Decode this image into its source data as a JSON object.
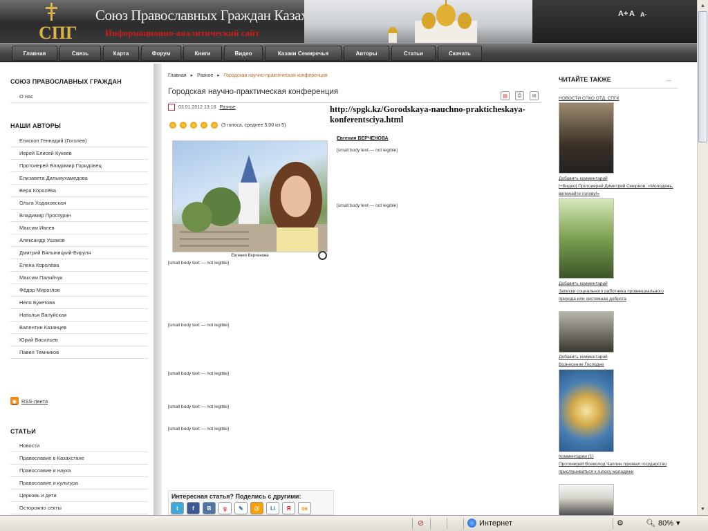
{
  "header": {
    "title": "Союз Православных Граждан Казахстана",
    "subtitle": "Информационно-аналитический сайт",
    "logo_text": "СПГ",
    "font_controls": [
      "A+",
      "A",
      "A-"
    ]
  },
  "nav": {
    "items": [
      "Главная",
      "Связь",
      "Карта",
      "Форум",
      "Книги",
      "Видео",
      "Казаки Семиречья",
      "Авторы",
      "Статьи",
      "Скачать"
    ]
  },
  "left": {
    "section1_title": "СОЮЗ ПРАВОСЛАВНЫХ ГРАЖДАН",
    "section1_items": [
      "О нас"
    ],
    "section2_title": "НАШИ АВТОРЫ",
    "authors": [
      "Епископ Геннадий (Гоголев)",
      "Иерей Елисей Кукеев",
      "Протоиерей Владимир Горидовец",
      "Елизавета Дильмухамедова",
      "Вера Королёва",
      "Ольга Ходаковская",
      "Владимир Проскурин",
      "Максим Ивлев",
      "Александр Ушаков",
      "Дмитрий Бялыницкий-Бируля",
      "Елена Королёва",
      "Максим Палийчук",
      "Фёдор Мироглов",
      "Неля Букетова",
      "Наталья Валуйская",
      "Валентин Казанцев",
      "Юрий Васильев",
      "Павел Темников"
    ],
    "rss_label": "RSS-лента",
    "section3_title": "СТАТЬИ",
    "articles": [
      "Новости",
      "Православие в Казахстане",
      "Православие и наука",
      "Православие и культура",
      "Церковь и дети",
      "Осторожно секты"
    ]
  },
  "main": {
    "breadcrumb": [
      "Главная",
      "Разное",
      "Городская научно-практическая конференция"
    ],
    "title": "Городская научно-практическая конференция",
    "date": "03.01.2012 13:16",
    "category": "Разное",
    "url_overlay": "http://spgk.kz/Gorodskaya-nauchno-prakticheskaya-konferentsciya.html",
    "rating_text": "(3 голоса, среднее 5.00 из 5)",
    "photo_caption": "Евгения Верченова",
    "author": "Евгения ВЕРЧЕНОВА",
    "paragraphs": [
      "[small body text — not legible]",
      "[small body text — not legible]",
      "[small body text — not legible]",
      "[small body text — not legible]",
      "[small body text — not legible]",
      "[small body text — not legible]",
      "[small body text — not legible]"
    ],
    "share_title": "Интересная статья? Поделись с другими:",
    "share_icons": [
      "twitter-icon",
      "facebook-icon",
      "vkontakte-icon",
      "google-icon",
      "livejournal-icon",
      "mailru-icon",
      "liveinternet-icon",
      "yandex-icon",
      "odnoklassniki-icon"
    ]
  },
  "right": {
    "title": "ЧИТАЙТЕ ТАКЖЕ",
    "items": [
      {
        "title": "НОВОСТИ СПКО ОТД. СПГК",
        "comment": "Добавить комментарий"
      },
      {
        "title": "[+Видео] Протоиерей Димитрий Смирнов: «Молодежь, включайте голову!»",
        "comment": "Добавить комментарий"
      },
      {
        "title": "Записки социального работника провинциального прихода или системная доброта",
        "comment": "Добавить комментарий"
      },
      {
        "title": "Вознесение Господне",
        "comment": "Комментарии (1)"
      },
      {
        "title": "Протоиерей Всеволод Чаплин призвал государство прислушиваться к голосу молодежи",
        "comment": ""
      }
    ]
  },
  "statusbar": {
    "zone": "Интернет",
    "zoom": "80%"
  }
}
